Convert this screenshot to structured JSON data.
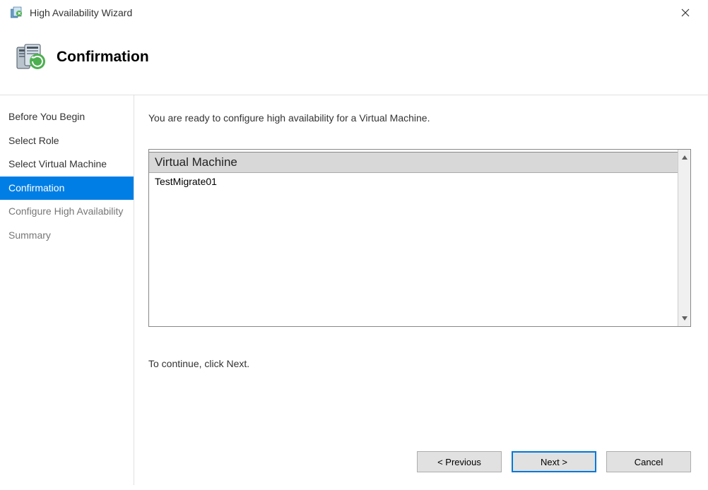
{
  "window": {
    "title": "High Availability Wizard"
  },
  "header": {
    "title": "Confirmation"
  },
  "sidebar": {
    "items": [
      {
        "label": "Before You Begin",
        "state": "completed"
      },
      {
        "label": "Select Role",
        "state": "completed"
      },
      {
        "label": "Select Virtual Machine",
        "state": "completed"
      },
      {
        "label": "Confirmation",
        "state": "current"
      },
      {
        "label": "Configure High Availability",
        "state": "future"
      },
      {
        "label": "Summary",
        "state": "future"
      }
    ]
  },
  "content": {
    "intro": "You are ready to configure high availability for a Virtual Machine.",
    "table": {
      "column_header": "Virtual Machine",
      "rows": [
        "TestMigrate01"
      ]
    },
    "continue_hint": "To continue, click Next."
  },
  "buttons": {
    "previous": "< Previous",
    "next": "Next >",
    "cancel": "Cancel"
  }
}
